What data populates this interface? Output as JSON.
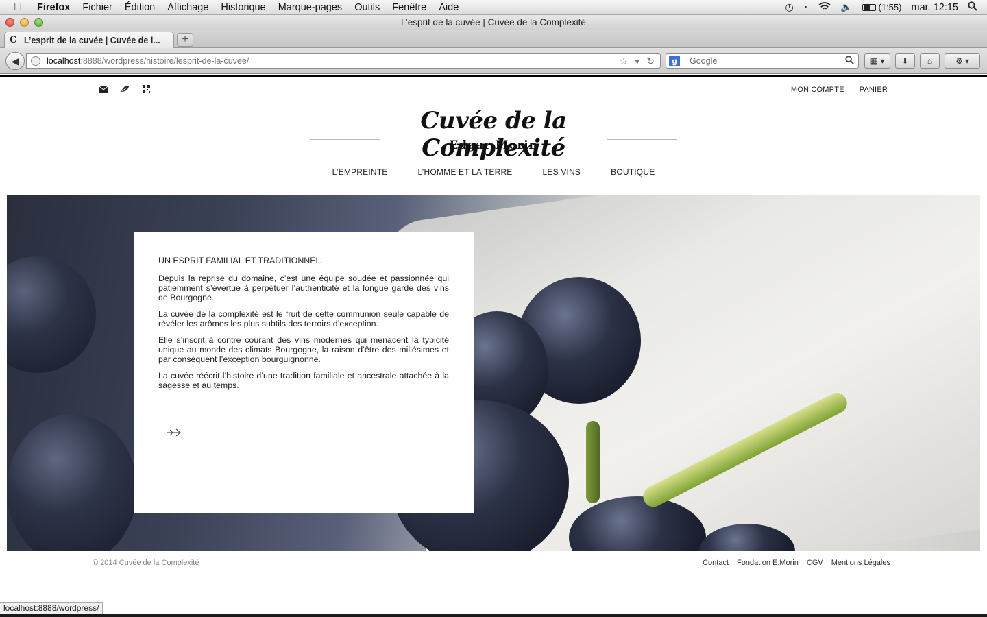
{
  "system_menu": {
    "app": "Firefox",
    "items": [
      "Fichier",
      "Édition",
      "Affichage",
      "Historique",
      "Marque-pages",
      "Outils",
      "Fenêtre",
      "Aide"
    ],
    "battery": "(1:55)",
    "clock": "mar. 12:15"
  },
  "window": {
    "title": "L’esprit de la cuvée | Cuvée de la Complexité"
  },
  "tab": {
    "label": "L’esprit de la cuvée | Cuvée de l...",
    "favicon": "C",
    "newtab": "+"
  },
  "toolbar": {
    "url_host": "localhost",
    "url_path": ":8888/wordpress/histoire/lesprit-de-la-cuvee/",
    "search_engine": "g",
    "search_placeholder": "Google"
  },
  "site": {
    "top_links": [
      "MON COMPTE",
      "PANIER"
    ],
    "logo_title": "Cuvée de la Complexité",
    "logo_subtitle": "Edgar Morin",
    "nav": [
      "L’EMPREINTE",
      "L’HOMME ET LA TERRE",
      "LES VINS",
      "BOUTIQUE"
    ]
  },
  "content": {
    "heading": "UN ESPRIT FAMILIAL ET TRADITIONNEL.",
    "paragraphs": [
      "Depuis la reprise du domaine, c’est une équipe soudée et passionnée qui patiemment s’évertue à perpétuer l’authenticité et la longue garde des vins de Bourgogne.",
      "La cuvée de la complexité est le fruit de cette communion seule capable de révéler les arômes les plus subtils des terroirs d’exception.",
      "Elle s’inscrit à contre courant des vins modernes qui menacent la typicité unique au monde des climats Bourgogne, la raison d’être des millésimes et par conséquent l’exception bourguignonne.",
      "La cuvée réécrit l’histoire d’une tradition familiale et ancestrale attachée à la sagesse et au temps."
    ]
  },
  "footer": {
    "copyright": "© 2014 Cuvée de la Complexité",
    "links": [
      "Contact",
      "Fondation E.Morin",
      "CGV",
      "Mentions Légales"
    ]
  },
  "status_bar": "localhost:8888/wordpress/",
  "icons": {
    "apple": "apple-icon",
    "time_machine": "time-machine-icon",
    "bluetooth": "bluetooth-icon",
    "wifi": "wifi-icon",
    "volume": "volume-icon",
    "spotlight": "spotlight-search-icon",
    "mail": "mail-icon",
    "leaf": "leaf-icon",
    "qr": "qr-code-icon",
    "next_arrow": "arrow-right-icon"
  }
}
